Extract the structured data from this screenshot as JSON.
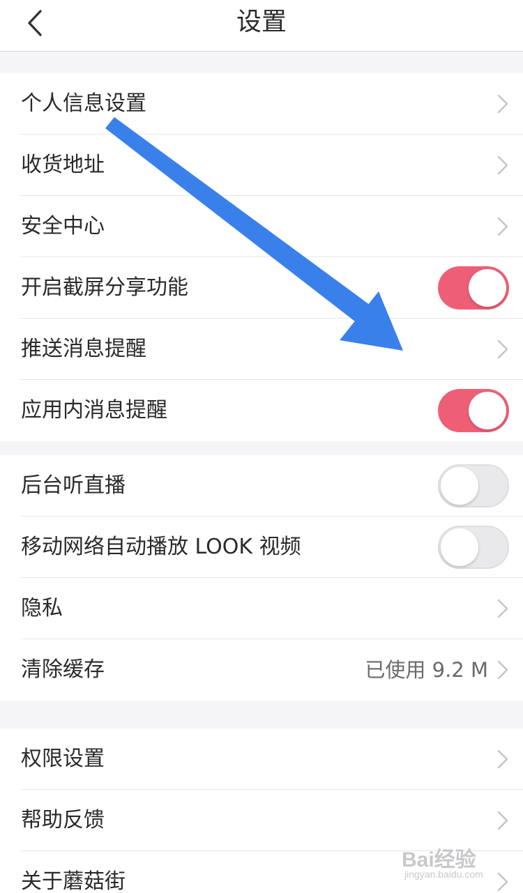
{
  "header": {
    "title": "设置",
    "back_icon": "chevron-left-icon"
  },
  "groups": [
    {
      "rows": [
        {
          "label": "个人信息设置",
          "accessory": "chevron"
        },
        {
          "label": "收货地址",
          "accessory": "chevron"
        },
        {
          "label": "安全中心",
          "accessory": "chevron"
        },
        {
          "label": "开启截屏分享功能",
          "accessory": "toggle",
          "toggle_on": true
        },
        {
          "label": "推送消息提醒",
          "accessory": "chevron"
        },
        {
          "label": "应用内消息提醒",
          "accessory": "toggle",
          "toggle_on": true
        }
      ]
    },
    {
      "rows": [
        {
          "label": "后台听直播",
          "accessory": "toggle",
          "toggle_on": false
        },
        {
          "label": "移动网络自动播放 LOOK 视频",
          "accessory": "toggle",
          "toggle_on": false
        },
        {
          "label": "隐私",
          "accessory": "chevron"
        },
        {
          "label": "清除缓存",
          "accessory": "chevron",
          "value": "已使用 9.2 M"
        }
      ]
    },
    {
      "rows": [
        {
          "label": "权限设置",
          "accessory": "chevron"
        },
        {
          "label": "帮助反馈",
          "accessory": "chevron"
        },
        {
          "label": "关于蘑菇街",
          "accessory": "chevron"
        }
      ]
    }
  ],
  "overlay": {
    "arrow_color": "#3a80ea",
    "arrow_icon": "annotation-arrow-icon"
  },
  "watermark": {
    "brand": "Bai经验",
    "url": "jingyan.baidu.com"
  },
  "colors": {
    "toggle_on": "#ee5f76",
    "toggle_off": "#e9e9ec",
    "chevron": "#c4c4c6"
  }
}
